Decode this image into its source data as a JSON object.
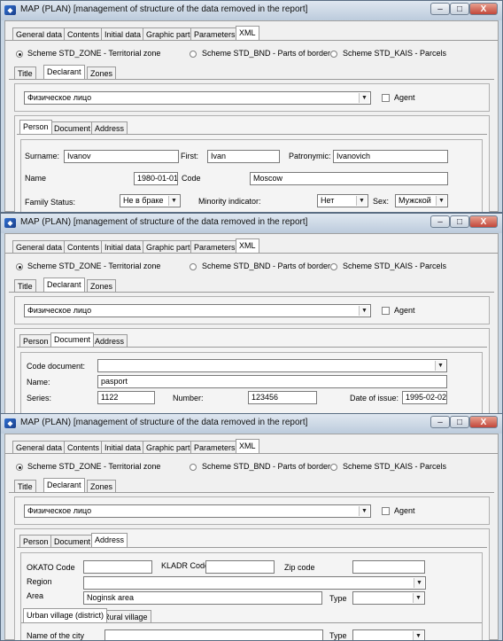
{
  "window_title": "MAP (PLAN) [management of structure of the data removed in the report]",
  "titlebar_buttons": {
    "minimize": "–",
    "maximize": "□",
    "close": "X"
  },
  "main_tabs": [
    "General data",
    "Contents",
    "Initial data",
    "Graphic part",
    "Parameters",
    "XML"
  ],
  "schemes": [
    "Scheme STD_ZONE - Territorial zone",
    "Scheme STD_BND - Parts of border",
    "Scheme STD_KAIS - Parcels"
  ],
  "sub_tabs": [
    "Title",
    "Declarant",
    "Zones"
  ],
  "declarant": {
    "type_value": "Физическое лицо",
    "agent_label": "Agent"
  },
  "person_tabs": [
    "Person",
    "Document",
    "Address"
  ],
  "person": {
    "surname_label": "Surname:",
    "surname": "Ivanov",
    "first_label": "First:",
    "first": "Ivan",
    "patronymic_label": "Patronymic:",
    "patronymic": "Ivanovich",
    "name_label": "Name",
    "birth_date": "1980-01-01",
    "code_label": "Code",
    "code": "Moscow",
    "family_status_label": "Family Status:",
    "family_status": "Не в браке",
    "minority_label": "Minority indicator:",
    "minority": "Нет",
    "sex_label": "Sex:",
    "sex": "Мужской"
  },
  "document": {
    "code_label": "Code document:",
    "code_value": "",
    "name_label": "Name:",
    "name_value": "pasport",
    "series_label": "Series:",
    "series": "1122",
    "number_label": "Number:",
    "number": "123456",
    "issue_label": "Date of issue:",
    "issue_date": "1995-02-02"
  },
  "address": {
    "okato_label": "OKATO Code",
    "okato": "",
    "kladr_label": "KLADR Code",
    "kladr": "",
    "zip_label": "Zip code",
    "zip": "",
    "region_label": "Region",
    "region": "",
    "area_label": "Area",
    "area": "Noginsk area",
    "type_label": "Type",
    "type_value": "",
    "village_tabs": [
      "Urban village (district)",
      "Rural village"
    ],
    "city_label": "Name of the city",
    "type2_label": "Type"
  }
}
